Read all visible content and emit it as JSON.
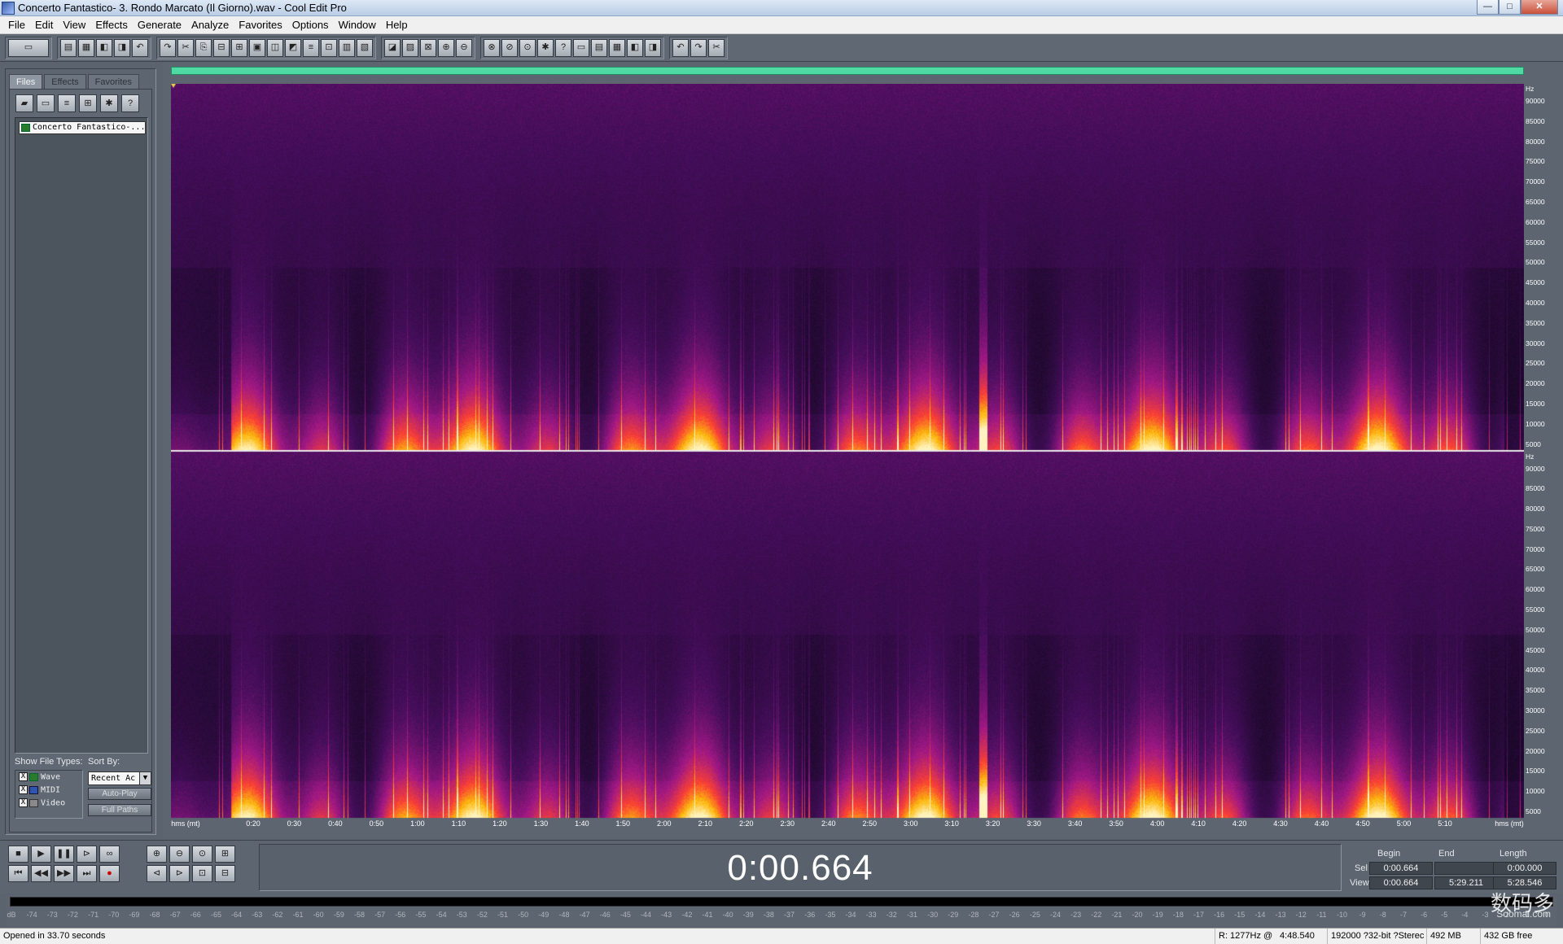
{
  "window": {
    "title": "Concerto Fantastico- 3. Rondo Marcato (Il Giorno).wav - Cool Edit Pro",
    "minimize": "—",
    "maximize": "□",
    "close": "✕"
  },
  "menu": [
    "File",
    "Edit",
    "View",
    "Effects",
    "Generate",
    "Analyze",
    "Favorites",
    "Options",
    "Window",
    "Help"
  ],
  "toolbar": {
    "groups": [
      {
        "name": "mode",
        "icons": [
          "multitrack-toggle-icon"
        ]
      },
      {
        "name": "file",
        "icons": [
          "new-icon",
          "open-icon",
          "save-icon",
          "save-all-icon",
          "close-file-icon"
        ]
      },
      {
        "name": "edit",
        "icons": [
          "undo-icon",
          "redo-icon",
          "repeat-icon",
          "copy-icon",
          "cut-icon",
          "paste-icon",
          "paste-new-icon",
          "mix-paste-icon",
          "trim-icon",
          "crop-icon",
          "silence-icon",
          "zero-cross-icon"
        ]
      },
      {
        "name": "view",
        "icons": [
          "spectral-view-icon",
          "waveform-view-icon",
          "spectral-pan-icon",
          "spectral-phase-icon",
          "show-grid-icon"
        ]
      },
      {
        "name": "tools",
        "icons": [
          "cd-icon",
          "metadata-icon",
          "scripts-icon",
          "play-list-icon",
          "cue-list-icon",
          "time-window-icon",
          "frequency-icon",
          "markers-icon",
          "info-icon",
          "settings-icon"
        ]
      },
      {
        "name": "help",
        "icons": [
          "settings-gear-icon",
          "context-help-icon",
          "help-icon"
        ]
      }
    ]
  },
  "left_panel": {
    "tabs": [
      "Files",
      "Effects",
      "Favorites"
    ],
    "active_tab": "Files",
    "file_tools": [
      "open-folder-icon",
      "close-file-icon",
      "insert-icon",
      "import-icon",
      "options-icon",
      "help-icon"
    ],
    "files": [
      "Concerto Fantastico-..."
    ],
    "show_types_label": "Show File Types:",
    "sort_by_label": "Sort By:",
    "types": [
      {
        "label": "Wave",
        "checked": "X"
      },
      {
        "label": "MIDI",
        "checked": "X"
      },
      {
        "label": "Video",
        "checked": "X"
      }
    ],
    "sort_value": "Recent Ac",
    "auto_play": "Auto-Play",
    "full_paths": "Full Paths"
  },
  "ruler": {
    "unit_top": "Hz",
    "unit_bottom": "Hz",
    "labels": [
      "90000",
      "85000",
      "80000",
      "75000",
      "70000",
      "65000",
      "60000",
      "55000",
      "50000",
      "45000",
      "40000",
      "35000",
      "30000",
      "25000",
      "20000",
      "15000",
      "10000",
      "5000"
    ]
  },
  "time_ruler": {
    "left_label": "hms (mt)",
    "right_label": "hms (mt)",
    "ticks": [
      "0:20",
      "0:30",
      "0:40",
      "0:50",
      "1:00",
      "1:10",
      "1:20",
      "1:30",
      "1:40",
      "1:50",
      "2:00",
      "2:10",
      "2:20",
      "2:30",
      "2:40",
      "2:50",
      "3:00",
      "3:10",
      "3:20",
      "3:30",
      "3:40",
      "3:50",
      "4:00",
      "4:10",
      "4:20",
      "4:30",
      "4:40",
      "4:50",
      "5:00",
      "5:10"
    ]
  },
  "transport": {
    "buttons_top": [
      "stop-icon",
      "play-icon",
      "pause-icon",
      "play-to-end-icon",
      "loop-icon"
    ],
    "buttons_bottom": [
      "go-to-start-icon",
      "rewind-icon",
      "fast-forward-icon",
      "go-to-end-icon",
      "record-icon"
    ],
    "zoom_top": [
      "zoom-in-icon",
      "zoom-out-icon",
      "zoom-full-icon",
      "zoom-vertical-in-icon"
    ],
    "zoom_bottom": [
      "zoom-left-icon",
      "zoom-right-icon",
      "zoom-selection-icon",
      "zoom-vertical-out-icon"
    ],
    "time": "0:00.664"
  },
  "selview": {
    "headers": [
      "Begin",
      "End",
      "Length"
    ],
    "sel_label": "Sel",
    "view_label": "View",
    "sel": [
      "0:00.664",
      "",
      "0:00.000"
    ],
    "view": [
      "0:00.664",
      "5:29.211",
      "5:28.546"
    ]
  },
  "meter": {
    "labels": [
      "dB",
      "-74",
      "-73",
      "-72",
      "-71",
      "-70",
      "-69",
      "-68",
      "-67",
      "-66",
      "-65",
      "-64",
      "-63",
      "-62",
      "-61",
      "-60",
      "-59",
      "-58",
      "-57",
      "-56",
      "-55",
      "-54",
      "-53",
      "-52",
      "-51",
      "-50",
      "-49",
      "-48",
      "-47",
      "-46",
      "-45",
      "-44",
      "-43",
      "-42",
      "-41",
      "-40",
      "-39",
      "-38",
      "-37",
      "-36",
      "-35",
      "-34",
      "-33",
      "-32",
      "-31",
      "-30",
      "-29",
      "-28",
      "-27",
      "-26",
      "-25",
      "-24",
      "-23",
      "-22",
      "-21",
      "-20",
      "-19",
      "-18",
      "-17",
      "-16",
      "-15",
      "-14",
      "-13",
      "-12",
      "-11",
      "-10",
      "-9",
      "-8",
      "-7",
      "-6",
      "-5",
      "-4",
      "-3",
      "-2",
      "-1",
      "0"
    ]
  },
  "status": {
    "message": "Opened in 33.70 seconds",
    "cursor": "R: 1277Hz @",
    "cursor_time": "4:48.540",
    "format": "192000 ?32-bit ?Sterec",
    "size": "492 MB",
    "free": "432 GB free"
  },
  "watermark": {
    "cn": "数码多",
    "en": "Soomal.com"
  },
  "colors": {
    "accent_overview": "#4fd9a3",
    "spectrogram_low": "#0a0616",
    "spectrogram_mid": "#5a1a6e",
    "spectrogram_hot": "#ff6a00"
  }
}
